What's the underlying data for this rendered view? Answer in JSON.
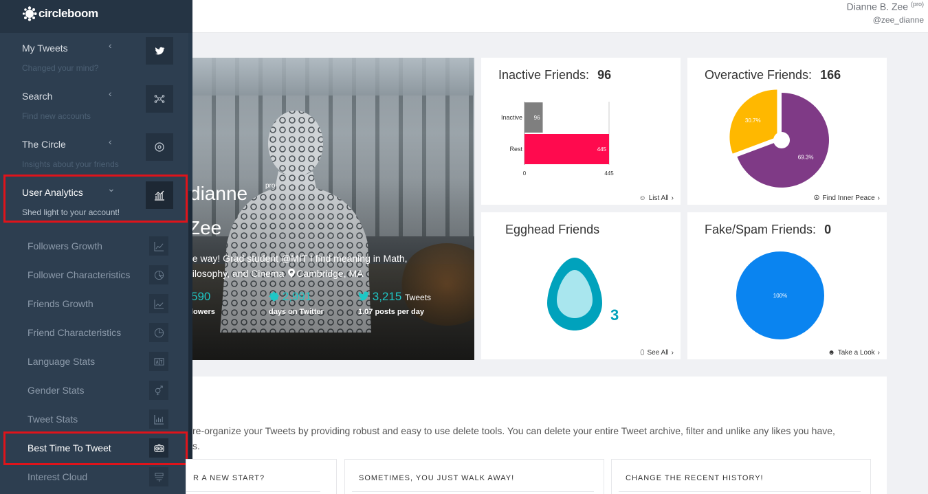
{
  "header": {
    "user_name": "Dianne B. Zee",
    "user_badge": "(pro)",
    "user_handle": "@zee_dianne"
  },
  "brand": {
    "name": "circleboom"
  },
  "sidebar": {
    "sections": [
      {
        "title": "My Tweets",
        "subtitle": "Changed your mind?",
        "icon": "twitter-icon"
      },
      {
        "title": "Search",
        "subtitle": "Find new accounts",
        "icon": "network-icon"
      },
      {
        "title": "The Circle",
        "subtitle": "Insights about your friends",
        "icon": "target-icon"
      },
      {
        "title": "User Analytics",
        "subtitle": "Shed light to your account!",
        "icon": "analytics-icon"
      }
    ],
    "items": [
      {
        "label": "Followers Growth",
        "icon": "area-chart-icon"
      },
      {
        "label": "Follower Characteristics",
        "icon": "pie-chart-icon"
      },
      {
        "label": "Friends Growth",
        "icon": "area-chart-icon"
      },
      {
        "label": "Friend Characteristics",
        "icon": "pie-chart-icon"
      },
      {
        "label": "Language Stats",
        "icon": "language-icon"
      },
      {
        "label": "Gender Stats",
        "icon": "gender-icon"
      },
      {
        "label": "Tweet Stats",
        "icon": "bar-chart-icon"
      },
      {
        "label": "Best Time To Tweet",
        "icon": "clock-icon"
      },
      {
        "label": "Interest Cloud",
        "icon": "cloud-list-icon"
      }
    ]
  },
  "profile": {
    "name_line1": "dianne",
    "name_line2": "Zee",
    "badge": "pro",
    "bio_line1": "he way! Grad student @MIT I find meaning in Math,",
    "bio_line2": "hilosophy, and Cinema",
    "location": "Cambridge, MA",
    "stats": {
      "followers_value": "590",
      "followers_label": "lowers",
      "days_value": "2,991",
      "days_label": "days on Twitter",
      "tweets_value": "3,215",
      "tweets_unit": "Tweets",
      "tweets_label": "1.07 posts per day"
    }
  },
  "cards": {
    "inactive": {
      "title": "Inactive Friends:",
      "count": "96",
      "link": "List All"
    },
    "overactive": {
      "title": "Overactive Friends:",
      "count": "166",
      "link": "Find Inner Peace"
    },
    "egghead": {
      "title": "Egghead Friends",
      "count": "3",
      "link": "See All"
    },
    "fakespam": {
      "title": "Fake/Spam Friends:",
      "count": "0",
      "link": "Take a Look"
    }
  },
  "lower": {
    "text_line1": "re-organize your Tweets by providing robust and easy to use delete tools. You can delete your entire Tweet archive, filter and unlike any likes you have,",
    "text_line2": "s.",
    "options": [
      "R A NEW START?",
      "SOMETIMES, YOU JUST WALK AWAY!",
      "CHANGE THE RECENT HISTORY!"
    ]
  },
  "chart_data": [
    {
      "type": "bar",
      "orientation": "horizontal",
      "categories": [
        "Inactive",
        "Rest"
      ],
      "values": [
        96,
        445
      ],
      "colors": [
        "#7f7f7f",
        "#ff0a4e"
      ],
      "xlim": [
        0,
        445
      ],
      "xticks": [
        "0",
        "445"
      ]
    },
    {
      "type": "pie",
      "labels": [
        "30.7%",
        "69.3%"
      ],
      "values": [
        30.7,
        69.3
      ],
      "colors": [
        "#ffb800",
        "#7f3a86"
      ]
    },
    {
      "type": "pie",
      "labels": [
        "100%"
      ],
      "values": [
        100
      ],
      "colors": [
        "#0a84f0"
      ]
    }
  ],
  "colors": {
    "sidebar_bg": "#2d3e50",
    "accent_teal": "#1ec7c6",
    "highlight_red": "#e0131a"
  }
}
